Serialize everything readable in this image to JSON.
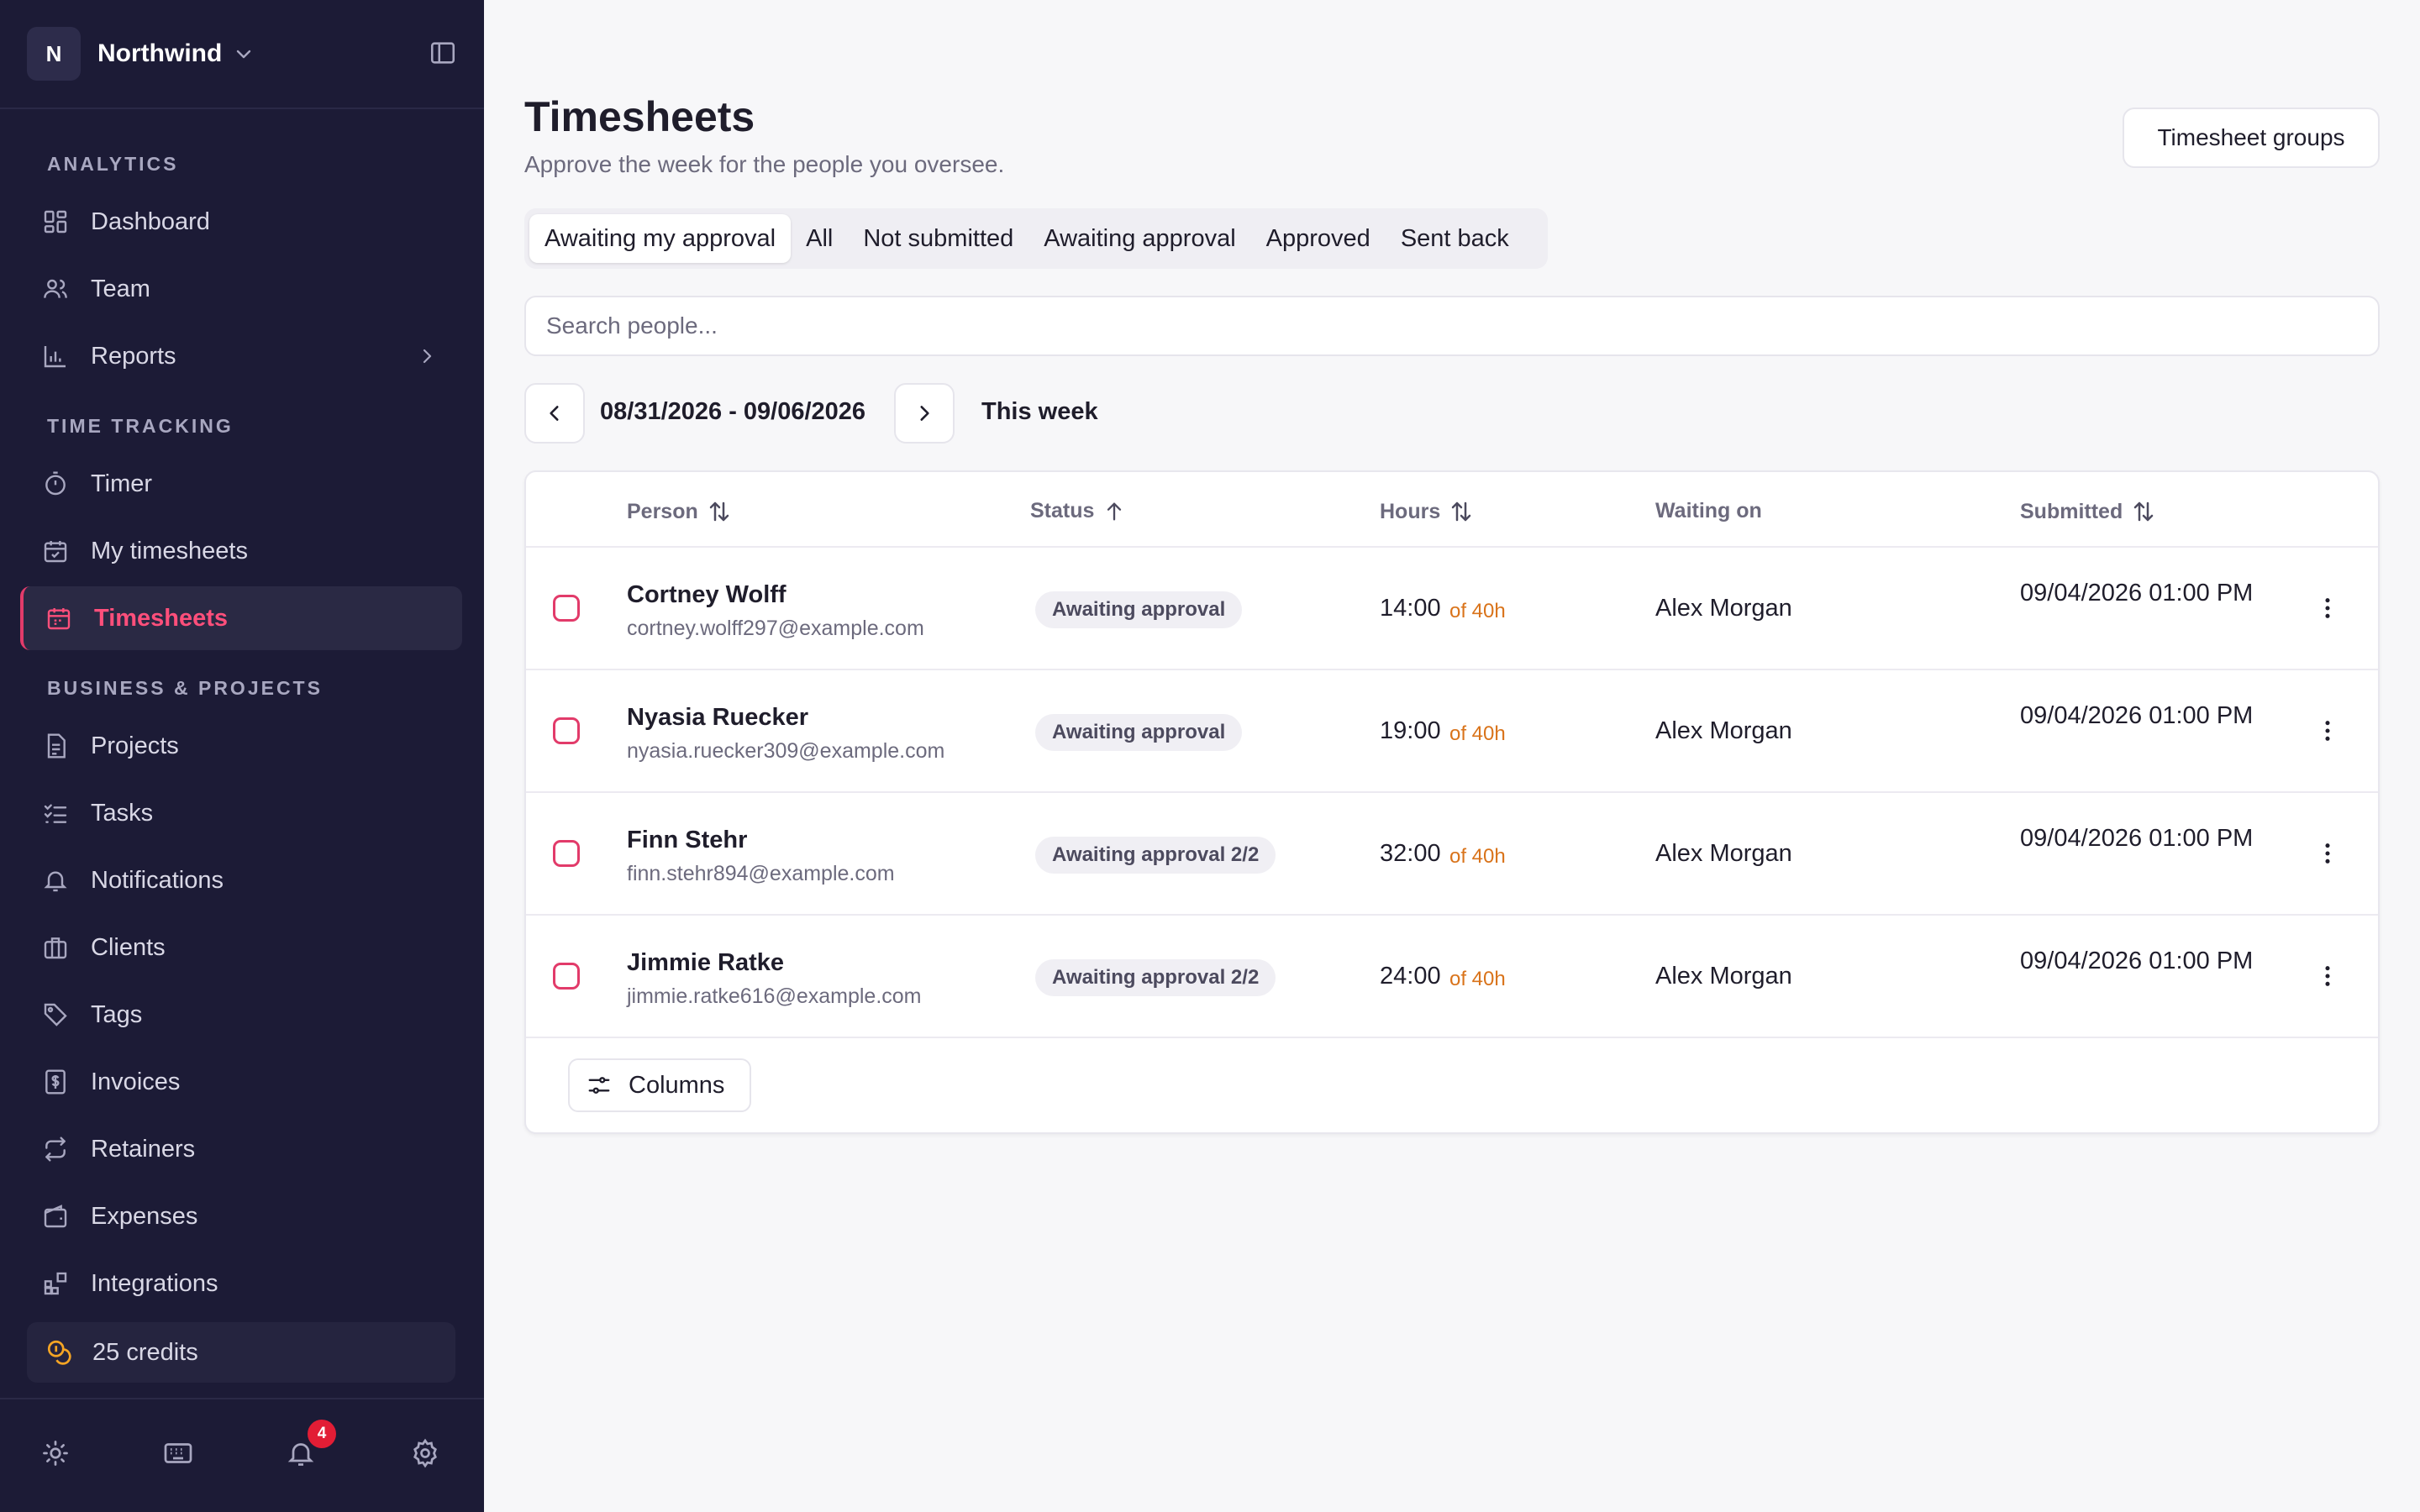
{
  "workspace": {
    "initial": "N",
    "name": "Northwind"
  },
  "sidebar": {
    "sections": [
      {
        "label": "ANALYTICS"
      },
      {
        "label": "TIME TRACKING"
      },
      {
        "label": "BUSINESS & PROJECTS"
      }
    ],
    "items": [
      {
        "label": "Dashboard",
        "icon": "dashboard-icon"
      },
      {
        "label": "Team",
        "icon": "team-icon"
      },
      {
        "label": "Reports",
        "icon": "reports-icon"
      },
      {
        "label": "Timer",
        "icon": "timer-icon"
      },
      {
        "label": "My timesheets",
        "icon": "calendar-icon"
      },
      {
        "label": "Timesheets",
        "icon": "calendar-icon",
        "active": true
      },
      {
        "label": "Projects",
        "icon": "document-icon"
      },
      {
        "label": "Tasks",
        "icon": "tasks-icon"
      },
      {
        "label": "Notifications",
        "icon": "bell-icon"
      },
      {
        "label": "Clients",
        "icon": "briefcase-icon"
      },
      {
        "label": "Tags",
        "icon": "tag-icon"
      },
      {
        "label": "Invoices",
        "icon": "invoice-icon"
      },
      {
        "label": "Retainers",
        "icon": "repeat-icon"
      },
      {
        "label": "Expenses",
        "icon": "wallet-icon"
      },
      {
        "label": "Integrations",
        "icon": "integrations-icon"
      }
    ],
    "credits": "25 credits",
    "notification_count": "4"
  },
  "page": {
    "title": "Timesheets",
    "subtitle": "Approve the week for the people you oversee.",
    "groups_button": "Timesheet groups"
  },
  "tabs": [
    "Awaiting my approval",
    "All",
    "Not submitted",
    "Awaiting approval",
    "Approved",
    "Sent back"
  ],
  "active_tab": "Awaiting my approval",
  "search": {
    "placeholder": "Search people..."
  },
  "date_range": {
    "label": "08/31/2026 - 09/06/2026",
    "this_week": "This week"
  },
  "table": {
    "headers": {
      "person": "Person",
      "status": "Status",
      "hours": "Hours",
      "waiting_on": "Waiting on",
      "submitted": "Submitted"
    },
    "rows": [
      {
        "name": "Cortney Wolff",
        "email": "cortney.wolff297@example.com",
        "status": "Awaiting approval",
        "hours": "14:00",
        "of": "of 40h",
        "waiting_on": "Alex Morgan",
        "submitted": "09/04/2026 01:00 PM"
      },
      {
        "name": "Nyasia Ruecker",
        "email": "nyasia.ruecker309@example.com",
        "status": "Awaiting approval",
        "hours": "19:00",
        "of": "of 40h",
        "waiting_on": "Alex Morgan",
        "submitted": "09/04/2026 01:00 PM"
      },
      {
        "name": "Finn Stehr",
        "email": "finn.stehr894@example.com",
        "status": "Awaiting approval 2/2",
        "hours": "32:00",
        "of": "of 40h",
        "waiting_on": "Alex Morgan",
        "submitted": "09/04/2026 01:00 PM"
      },
      {
        "name": "Jimmie Ratke",
        "email": "jimmie.ratke616@example.com",
        "status": "Awaiting approval 2/2",
        "hours": "24:00",
        "of": "of 40h",
        "waiting_on": "Alex Morgan",
        "submitted": "09/04/2026 01:00 PM"
      }
    ],
    "columns_button": "Columns"
  },
  "colors": {
    "sidebar_bg": "#1c1b36",
    "accent": "#e23b6a",
    "hours_of": "#d9731a",
    "badge": "#e21d35"
  }
}
